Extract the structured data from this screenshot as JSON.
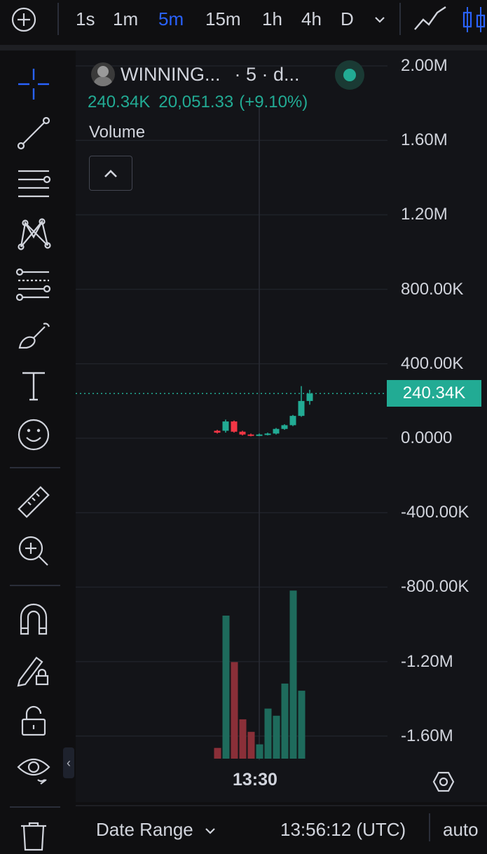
{
  "toolbar": {
    "timeframes": [
      "1s",
      "1m",
      "5m",
      "15m",
      "1h",
      "4h",
      "D"
    ],
    "active_timeframe": "5m",
    "icons": [
      "add-icon",
      "chevron-down-icon",
      "line-chart-icon",
      "candles-icon"
    ]
  },
  "legend": {
    "symbol": "WINNING...",
    "interval": "· 5 · d...",
    "values": [
      "240.34K",
      "20,051.33",
      "(+9.10%)"
    ],
    "indicator": "Volume",
    "status": "live"
  },
  "chart_data": {
    "type": "candlestick",
    "y_ticks": [
      "2.00M",
      "1.60M",
      "1.20M",
      "800.00K",
      "400.00K",
      "0.0000",
      "-400.00K",
      "-800.00K",
      "-1.20M",
      "-1.60M"
    ],
    "ylim": [
      -1.75,
      2.0
    ],
    "y_unit": "M",
    "last_price_label": "240.34K",
    "last_price": 0.24,
    "x_tick": "13:30",
    "candles": [
      {
        "o": 0.04,
        "c": 0.03,
        "h": 0.045,
        "l": 0.025,
        "up": false
      },
      {
        "o": 0.04,
        "c": 0.09,
        "h": 0.1,
        "l": 0.03,
        "up": true
      },
      {
        "o": 0.09,
        "c": 0.035,
        "h": 0.095,
        "l": 0.03,
        "up": false
      },
      {
        "o": 0.035,
        "c": 0.02,
        "h": 0.04,
        "l": 0.015,
        "up": false
      },
      {
        "o": 0.02,
        "c": 0.015,
        "h": 0.025,
        "l": 0.01,
        "up": false
      },
      {
        "o": 0.015,
        "c": 0.02,
        "h": 0.025,
        "l": 0.012,
        "up": true
      },
      {
        "o": 0.02,
        "c": 0.025,
        "h": 0.03,
        "l": 0.015,
        "up": true
      },
      {
        "o": 0.025,
        "c": 0.05,
        "h": 0.055,
        "l": 0.02,
        "up": true
      },
      {
        "o": 0.05,
        "c": 0.07,
        "h": 0.075,
        "l": 0.045,
        "up": true
      },
      {
        "o": 0.07,
        "c": 0.12,
        "h": 0.125,
        "l": 0.065,
        "up": true
      },
      {
        "o": 0.12,
        "c": 0.2,
        "h": 0.28,
        "l": 0.115,
        "up": true
      },
      {
        "o": 0.2,
        "c": 0.24,
        "h": 0.26,
        "l": 0.18,
        "up": true
      }
    ],
    "volume_relative": [
      0.06,
      0.8,
      0.54,
      0.22,
      0.15,
      0.08,
      0.28,
      0.24,
      0.42,
      0.94,
      0.38
    ]
  },
  "colors": {
    "up": "#22ab94",
    "down": "#f23645",
    "accent": "#2962ff",
    "background": "#131418"
  },
  "left_tools": [
    "crosshair-icon",
    "trend-line-icon",
    "horizontal-lines-icon",
    "pattern-icon",
    "fib-icon",
    "brush-icon",
    "text-icon",
    "emoji-icon",
    "ruler-icon",
    "zoom-in-icon",
    "magnet-icon",
    "lock-drawing-icon",
    "unlock-icon",
    "eye-icon",
    "trash-icon"
  ],
  "bottom": {
    "date_range": "Date Range",
    "clock": "13:56:12 (UTC)",
    "scale_mode": "auto"
  }
}
